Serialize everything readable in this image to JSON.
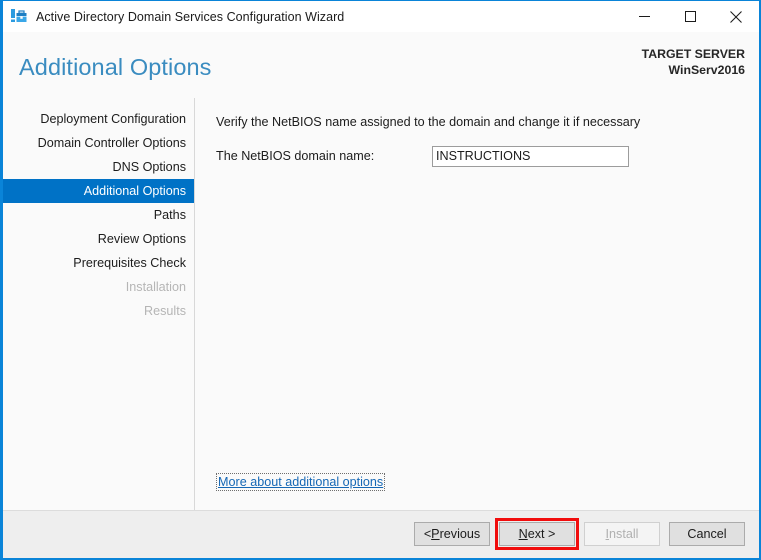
{
  "window": {
    "title": "Active Directory Domain Services Configuration Wizard",
    "icon": "ad-ds-wizard-icon",
    "controls": {
      "minimize": "minimize-icon",
      "maximize": "maximize-icon",
      "close": "close-icon"
    },
    "accent_color": "#0a84d8"
  },
  "header": {
    "page_title": "Additional Options",
    "target_server_label": "TARGET SERVER",
    "target_server_name": "WinServ2016",
    "title_color": "#3a8cc0"
  },
  "nav": {
    "items": [
      {
        "label": "Deployment Configuration",
        "state": "normal"
      },
      {
        "label": "Domain Controller Options",
        "state": "normal"
      },
      {
        "label": "DNS Options",
        "state": "normal"
      },
      {
        "label": "Additional Options",
        "state": "selected"
      },
      {
        "label": "Paths",
        "state": "normal"
      },
      {
        "label": "Review Options",
        "state": "normal"
      },
      {
        "label": "Prerequisites Check",
        "state": "normal"
      },
      {
        "label": "Installation",
        "state": "disabled"
      },
      {
        "label": "Results",
        "state": "disabled"
      }
    ],
    "selected_color": "#0072c6"
  },
  "content": {
    "instruction": "Verify the NetBIOS name assigned to the domain and change it if necessary",
    "netbios_label": "The NetBIOS domain name:",
    "netbios_value": "INSTRUCTIONS",
    "netbios_placeholder": "",
    "more_link": "More about additional options"
  },
  "footer": {
    "buttons": [
      {
        "label": "< Previous",
        "accel_prefix": "< ",
        "accel": "P",
        "accel_suffix": "revious",
        "state": "enabled",
        "annotated": false
      },
      {
        "label": "Next >",
        "accel_prefix": "",
        "accel": "N",
        "accel_suffix": "ext >",
        "state": "enabled",
        "annotated": true
      },
      {
        "label": "Install",
        "accel_prefix": "",
        "accel": "I",
        "accel_suffix": "nstall",
        "state": "disabled",
        "annotated": false
      },
      {
        "label": "Cancel",
        "accel_prefix": "",
        "accel": "",
        "accel_suffix": "Cancel",
        "state": "enabled",
        "annotated": false
      }
    ],
    "annotation_color": "#f10d0d"
  }
}
